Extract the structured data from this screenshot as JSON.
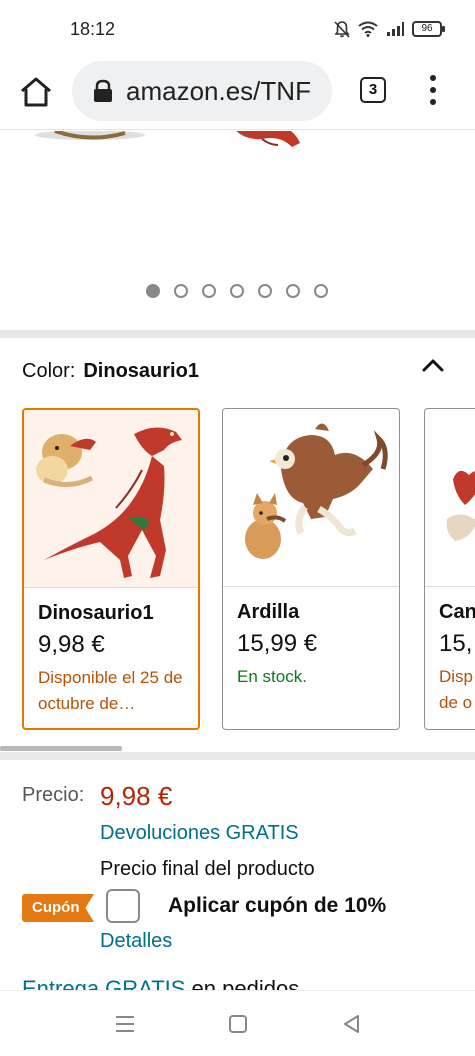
{
  "status_bar": {
    "time": "18:12",
    "battery": "96",
    "icons": [
      "bell-muted-icon",
      "wifi-icon",
      "signal-icon",
      "battery-icon"
    ]
  },
  "browser": {
    "url": "amazon.es/TNF",
    "tabs_count": "3",
    "icons": [
      "home-icon",
      "lock-icon",
      "tabs-icon",
      "more-vert-icon"
    ]
  },
  "gallery": {
    "dot_count": 7,
    "active_index": 0
  },
  "color_selector": {
    "label": "Color:",
    "selected": "Dinosaurio1",
    "variants": [
      {
        "name": "Dinosaurio1",
        "price": "9,98 €",
        "availability": "Disponible el 25 de octubre de…",
        "availability_color": "#b45309",
        "selected": true
      },
      {
        "name": "Ardilla",
        "price": "15,99 €",
        "availability": "En stock.",
        "availability_color": "#067d19",
        "selected": false
      },
      {
        "name": "Can",
        "price": "15,",
        "availability": "Disp de o",
        "availability_color": "#b45309",
        "selected": false
      }
    ]
  },
  "pricing": {
    "price_label": "Precio:",
    "price_value": "9,98 €",
    "returns": "Devoluciones GRATIS",
    "final_price": "Precio final del producto",
    "coupon_badge": "Cupón",
    "coupon_text": "Aplicar cupón de 10%",
    "details": "Detalles",
    "delivery_link": "Entrega GRATIS",
    "delivery_rest": " en pedidos"
  },
  "colors": {
    "accent_orange": "#e77600",
    "price_red": "#b12704",
    "link_teal": "#007185",
    "stock_green": "#067d19"
  }
}
